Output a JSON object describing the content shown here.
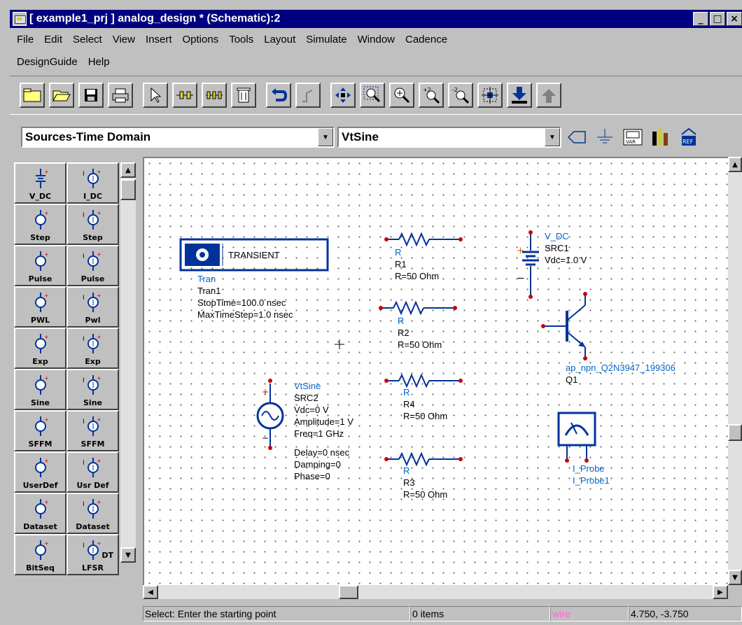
{
  "window": {
    "title": "[ example1_prj ] analog_design * (Schematic):2",
    "min_glyph": "_",
    "max_glyph": "□",
    "close_glyph": "×"
  },
  "menu": {
    "row1": [
      "File",
      "Edit",
      "Select",
      "View",
      "Insert",
      "Options",
      "Tools",
      "Layout",
      "Simulate",
      "Window",
      "Cadence"
    ],
    "row2": [
      "DesignGuide",
      "Help"
    ]
  },
  "toolbar": {
    "icons": [
      "folder-new-icon",
      "folder-open-icon",
      "save-icon",
      "print-icon",
      "select-pointer-icon",
      "insert-pin-icon",
      "insert-pin-multi-icon",
      "delete-icon",
      "undo-icon",
      "redo-icon",
      "move-icon",
      "zoom-area-icon",
      "zoom-in-icon",
      "zoom-in-2-icon",
      "zoom-out-2-icon",
      "view-all-icon",
      "push-down-icon",
      "pop-up-icon"
    ]
  },
  "palette_bar": {
    "library": "Sources-Time Domain",
    "component": "VtSine"
  },
  "palette": {
    "items": [
      {
        "label": "V_DC"
      },
      {
        "label": "I_DC"
      },
      {
        "label": "Step"
      },
      {
        "label": "Step"
      },
      {
        "label": "Pulse"
      },
      {
        "label": "Pulse"
      },
      {
        "label": "PWL"
      },
      {
        "label": "Pwl"
      },
      {
        "label": "Exp"
      },
      {
        "label": "Exp"
      },
      {
        "label": "Sine"
      },
      {
        "label": "Sine"
      },
      {
        "label": "SFFM"
      },
      {
        "label": "SFFM"
      },
      {
        "label": "UserDef"
      },
      {
        "label": "Usr Def"
      },
      {
        "label": "Dataset"
      },
      {
        "label": "Dataset"
      },
      {
        "label": "BitSeq"
      },
      {
        "label": "LFSR"
      }
    ],
    "lfsr_suffix": "DT"
  },
  "schematic": {
    "tran": {
      "box_label": "TRANSIENT",
      "lines": [
        "Tran",
        "Tran1",
        "StopTime=100.0 nsec",
        "MaxTimeStep=1.0 nsec"
      ]
    },
    "vtsine": {
      "lines": [
        "VtSine",
        "SRC2",
        "Vdc=0 V",
        "Amplitude=1 V",
        "Freq=1 GHz",
        "Delay=0 nsec",
        "Damping=0",
        "Phase=0"
      ]
    },
    "r1": {
      "lines": [
        "R",
        "R1",
        "R=50 Ohm"
      ]
    },
    "r2": {
      "lines": [
        "R",
        "R2",
        "R=50 Ohm"
      ]
    },
    "r4": {
      "lines": [
        "R",
        "R4",
        "R=50 Ohm"
      ]
    },
    "r3": {
      "lines": [
        "R",
        "R3",
        "R=50 Ohm"
      ]
    },
    "vdc": {
      "lines": [
        "V_DC",
        "SRC1",
        "Vdc=1.0 V"
      ]
    },
    "q1": {
      "lines": [
        "ap_npn_Q2N3947_199306",
        "Q1"
      ]
    },
    "probe": {
      "lines": [
        "I_Probe",
        "I_Probe1"
      ]
    }
  },
  "status": {
    "message": "Select: Enter the starting point",
    "items": "0 items",
    "mode": "wire",
    "coords": "4.750, -3.750"
  },
  "colors": {
    "titlebar": "#000080",
    "wire_label": "#0066cc",
    "schematic_text": "#000000",
    "pin": "#cc0000",
    "mode_text": "#ff66cc"
  }
}
